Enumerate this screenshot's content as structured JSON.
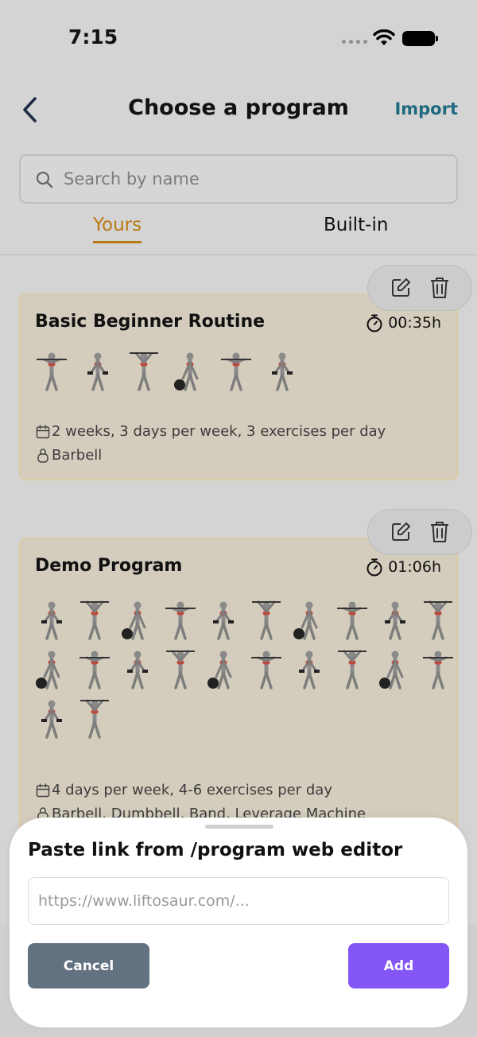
{
  "status_bar": {
    "time": "7:15"
  },
  "header": {
    "title": "Choose a program",
    "import_label": "Import"
  },
  "search": {
    "placeholder": "Search by name"
  },
  "tabs": [
    {
      "label": "Yours",
      "active": true
    },
    {
      "label": "Built-in",
      "active": false
    }
  ],
  "programs": [
    {
      "name": "Basic Beginner Routine",
      "duration": "00:35h",
      "schedule": "2 weeks, 3 days per week, 3 exercises per day",
      "equipment": "Barbell",
      "exercise_thumbnail_count": 6
    },
    {
      "name": "Demo Program",
      "duration": "01:06h",
      "schedule": "4 days per week, 4-6 exercises per day",
      "equipment": "Barbell, Dumbbell, Band, Leverage Machine",
      "exercise_thumbnail_count": 22
    }
  ],
  "import_sheet": {
    "title": "Paste link from /program web editor",
    "input_placeholder": "https://www.liftosaur.com/...",
    "cancel_label": "Cancel",
    "add_label": "Add"
  },
  "colors": {
    "accent_tab": "#b87a14",
    "import_link": "#1e6a80",
    "add_button": "#8356f5",
    "cancel_button": "#637281",
    "card_border": "#e2c78f"
  }
}
